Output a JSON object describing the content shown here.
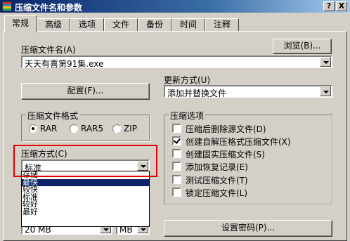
{
  "window": {
    "title": "压缩文件名和参数",
    "help_label": "?",
    "close_label": "X"
  },
  "tabs": [
    "常规",
    "高级",
    "选项",
    "文件",
    "备份",
    "时间",
    "注释"
  ],
  "archive_name": {
    "label": "压缩文件名(A)",
    "value": "天天有喜第91集.exe",
    "browse_label": "浏览(B)..."
  },
  "update_mode": {
    "label": "更新方式(U)",
    "value": "添加并替换文件"
  },
  "profile_button": "配置(F)...",
  "archive_format": {
    "label": "压缩文件格式",
    "options": [
      "RAR",
      "RAR5",
      "ZIP"
    ],
    "selected": "RAR"
  },
  "compression_method": {
    "label": "压缩方式(C)",
    "value": "标准",
    "options": [
      "存储",
      "最快",
      "较快",
      "标准",
      "较好",
      "最好"
    ],
    "highlighted": "最快"
  },
  "volume_size": {
    "value": "20 MB",
    "unit": "MB"
  },
  "archive_options": {
    "label": "压缩选项",
    "items": [
      {
        "label": "压缩后删除源文件(D)",
        "checked": false
      },
      {
        "label": "创建自解压格式压缩文件(X)",
        "checked": true
      },
      {
        "label": "创建固实压缩文件(S)",
        "checked": false
      },
      {
        "label": "添加恢复记录(E)",
        "checked": false
      },
      {
        "label": "测试压缩文件(T)",
        "checked": false
      },
      {
        "label": "锁定压缩文件(L)",
        "checked": false
      }
    ]
  },
  "set_password_button": "设置密码(P)...",
  "colors": {
    "titlebar": "#0a246a",
    "highlight_box": "#e00000",
    "selection": "#0a246a"
  }
}
